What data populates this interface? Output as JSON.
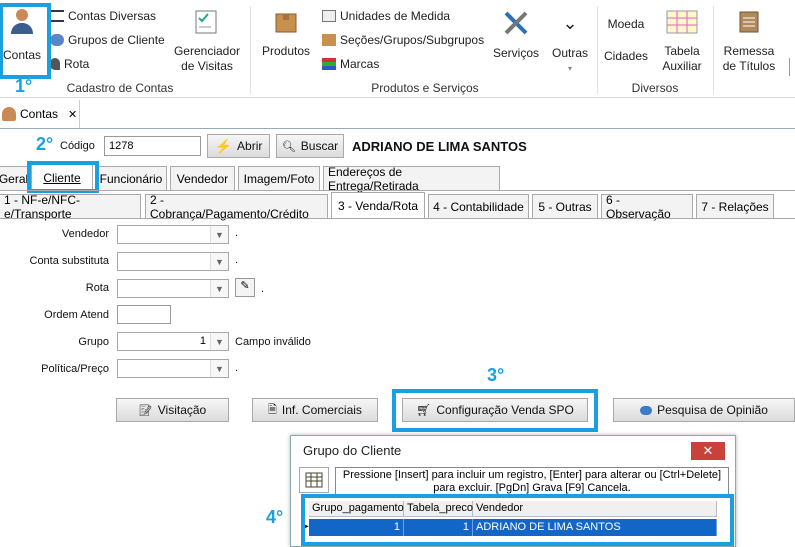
{
  "ribbon": {
    "contas_label": "Contas",
    "small_items": [
      "Contas Diversas",
      "Grupos de Cliente",
      "Rota"
    ],
    "gerenciador_label": "Gerenciador\nde Visitas",
    "group_cadastro": "Cadastro de Contas",
    "produtos_label": "Produtos",
    "mid_items": [
      "Unidades de Medida",
      "Seções/Grupos/Subgrupos",
      "Marcas"
    ],
    "servicos_label": "Serviços",
    "outras_label": "Outras",
    "group_produtos": "Produtos e Serviços",
    "moeda_label": "Moeda",
    "cidades_label": "Cidades",
    "tabela_label": "Tabela\nAuxiliar",
    "group_diversos": "Diversos",
    "remessa_label": "Remessa\nde Títulos"
  },
  "steps": [
    "1°",
    "2°",
    "3°",
    "4°"
  ],
  "doc_tab": {
    "label": "Contas",
    "close": "✕"
  },
  "header": {
    "codigo_label": "Código",
    "codigo_value": "1278",
    "abrir": "Abrir",
    "buscar": "Buscar",
    "client_name": "ADRIANO DE LIMA SANTOS"
  },
  "tabs_main": [
    "Geral",
    "Cliente",
    "Funcionário",
    "Vendedor",
    "Imagem/Foto",
    "Endereços de Entrega/Retirada"
  ],
  "tabs_sub": [
    "1 - NF-e/NFC-e/Transporte",
    "2 - Cobrança/Pagamento/Crédito",
    "3 - Venda/Rota",
    "4 - Contabilidade",
    "5 - Outras",
    "6 - Observação",
    "7 - Relações"
  ],
  "form": {
    "vendedor": "Vendedor",
    "conta_substituta": "Conta substituta",
    "rota": "Rota",
    "ordem_atend": "Ordem Atend",
    "grupo": "Grupo",
    "grupo_value": "1",
    "grupo_status": "Campo  inválido",
    "politica": "Política/Preço",
    "dot": "."
  },
  "buttons": {
    "visitacao": "Visitação",
    "inf_comerciais": "Inf. Comerciais",
    "config_venda": "Configuração Venda SPO",
    "pesquisa": "Pesquisa de Opinião"
  },
  "dialog": {
    "title": "Grupo do Cliente",
    "close": "✕",
    "hint": "Pressione [Insert] para incluir um registro, [Enter] para alterar ou [Ctrl+Delete] para excluir. [PgDn] Grava [F9] Cancela.",
    "columns": [
      "Grupo_pagamento",
      "Tabela_preco",
      "Vendedor"
    ],
    "row": [
      "1",
      "1",
      "ADRIANO DE LIMA SANTOS"
    ]
  },
  "colors": {
    "accent": "#1aa0e0",
    "selection": "#1266c8",
    "close_red": "#c8413a"
  }
}
